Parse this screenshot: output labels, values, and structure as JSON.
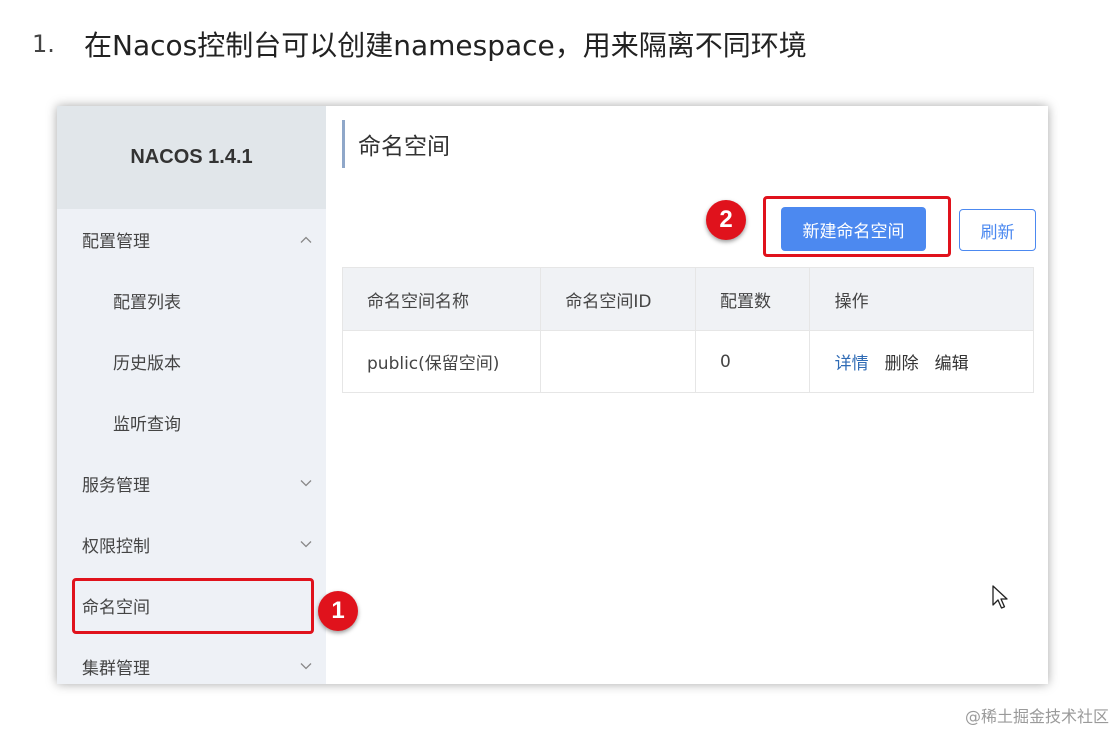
{
  "heading": {
    "number": "1.",
    "text": "在Nacos控制台可以创建namespace，用来隔离不同环境"
  },
  "app": {
    "brand": "NACOS 1.4.1"
  },
  "sidebar": {
    "items": [
      {
        "label": "配置管理",
        "chevron": "chevron-up-icon"
      },
      {
        "label": "配置列表"
      },
      {
        "label": "历史版本"
      },
      {
        "label": "监听查询"
      },
      {
        "label": "服务管理",
        "chevron": "chevron-down-icon"
      },
      {
        "label": "权限控制",
        "chevron": "chevron-down-icon"
      },
      {
        "label": "命名空间",
        "active": true
      },
      {
        "label": "集群管理",
        "chevron": "chevron-down-icon"
      }
    ]
  },
  "main": {
    "title": "命名空间",
    "new_button": "新建命名空间",
    "refresh_button": "刷新",
    "table": {
      "columns": [
        "命名空间名称",
        "命名空间ID",
        "配置数",
        "操作"
      ],
      "rows": [
        {
          "name": "public(保留空间)",
          "id": "",
          "count": "0",
          "actions": [
            "详情",
            "删除",
            "编辑"
          ]
        }
      ]
    }
  },
  "annotations": {
    "badge1": "1",
    "badge2": "2"
  },
  "watermark": "@稀土掘金技术社区",
  "colors": {
    "primary": "#4c89f0",
    "highlight": "#e0121c",
    "sidebar_bg": "#eef1f6",
    "link": "#2f6bb5"
  }
}
